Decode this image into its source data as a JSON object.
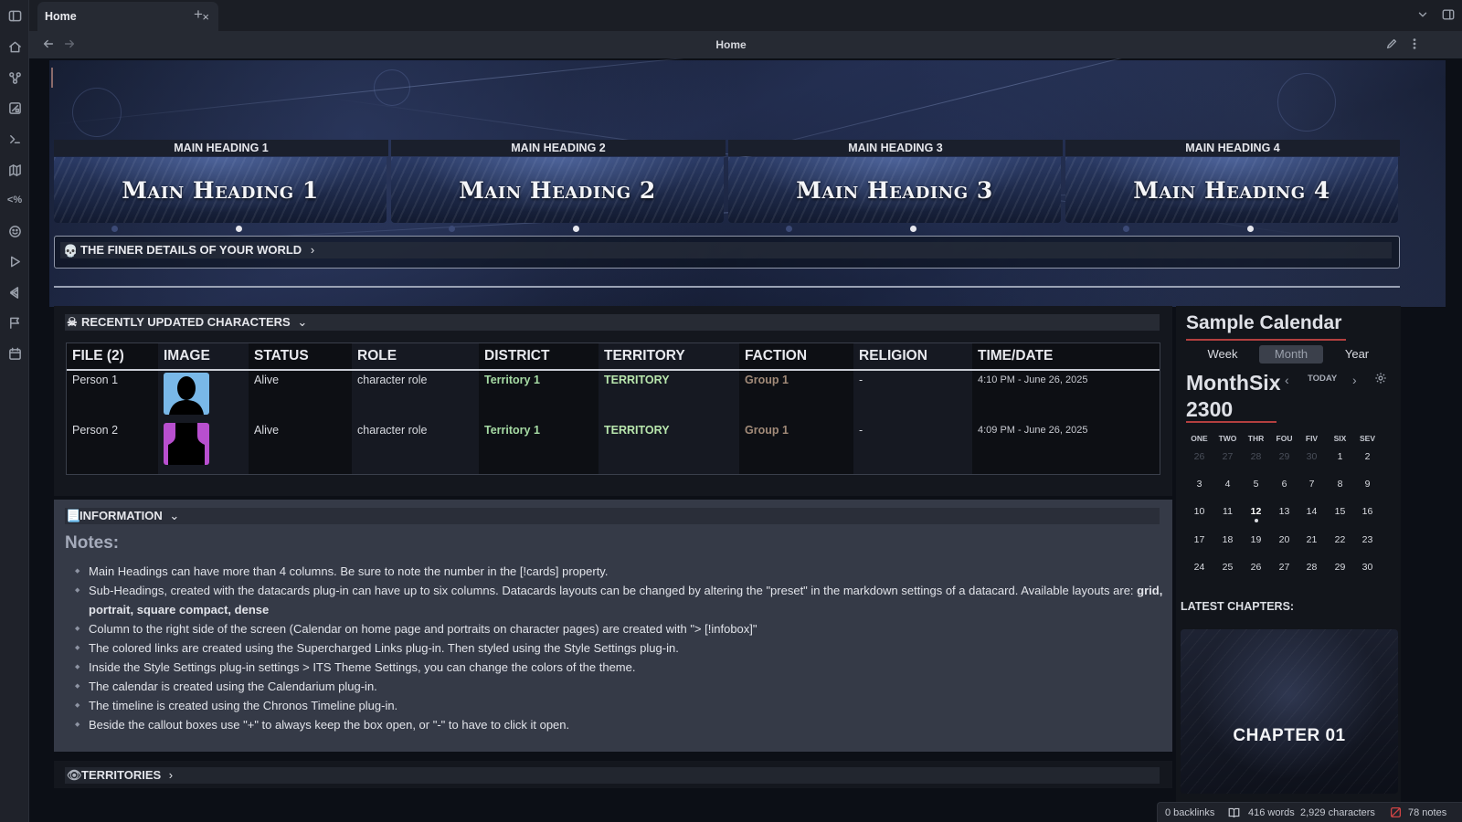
{
  "tabs": {
    "active": "Home",
    "close_glyph": "×",
    "new_glyph": "+"
  },
  "view": {
    "title": "Home"
  },
  "ribbon": [
    "sidebar-toggle-icon",
    "home-icon",
    "graph-icon",
    "canvas-icon",
    "terminal-icon",
    "map-icon",
    "percent-code-icon",
    "emoji-icon",
    "play-icon",
    "vscode-icon",
    "flag-icon",
    "calendar-icon"
  ],
  "cards": [
    {
      "label": "MAIN HEADING 1",
      "title": "Main Heading 1"
    },
    {
      "label": "MAIN HEADING 2",
      "title": "Main Heading 2"
    },
    {
      "label": "MAIN HEADING 3",
      "title": "Main Heading 3"
    },
    {
      "label": "MAIN HEADING 4",
      "title": "Main Heading 4"
    }
  ],
  "finer": {
    "icon": "💀",
    "label": "THE FINER DETAILS OF YOUR WORLD",
    "chevron": "›"
  },
  "characters": {
    "icon": "☠",
    "heading": "RECENTLY UPDATED CHARACTERS",
    "chevron": "⌄",
    "columns": [
      "FILE (2)",
      "IMAGE",
      "STATUS",
      "ROLE",
      "DISTRICT",
      "TERRITORY",
      "FACTION",
      "RELIGION",
      "TIME/DATE"
    ],
    "rows": [
      {
        "file": "Person 1",
        "portrait_color": "#79b8e8",
        "status": "Alive",
        "role": "character role",
        "district": "Territory 1",
        "territory": "TERRITORY",
        "faction": "Group 1",
        "religion": "-",
        "time": "4:10 PM - June 26, 2025"
      },
      {
        "file": "Person 2",
        "portrait_color": "#b84fcf",
        "status": "Alive",
        "role": "character role",
        "district": "Territory 1",
        "territory": "TERRITORY",
        "faction": "Group 1",
        "religion": "-",
        "time": "4:09 PM - June 26, 2025"
      }
    ]
  },
  "information": {
    "icon": "📃",
    "heading": "INFORMATION",
    "chevron": "⌄",
    "notes_title": "Notes:",
    "notes": [
      "Main Headings can have more than 4 columns. Be sure to note the number in the [!cards] property.",
      "Sub-Headings, created with the datacards plug-in can have up to six columns. Datacards layouts can be changed by altering the \"preset\" in the markdown settings of a datacard. Available layouts are: ",
      "Column to the right side of the screen (Calendar on home page and portraits on character pages) are created with \"> [!infobox]\"",
      "The colored links are created using the Supercharged Links plug-in. Then styled using the Style Settings plug-in.",
      "Inside the Style Settings plug-in settings > ITS Theme Settings, you can change the colors of the theme.",
      "The calendar is created using the Calendarium plug-in.",
      "The timeline is created using the Chronos Timeline plug-in.",
      "Beside the callout boxes use \"+\" to always keep the box open, or \"-\" to have to click it open."
    ],
    "layouts_bold": "grid, portrait, square compact, dense"
  },
  "territories": {
    "icon": "👁",
    "heading": "TERRITORIES",
    "chevron": "›"
  },
  "calendar": {
    "title": "Sample Calendar",
    "views": [
      "Week",
      "Month",
      "Year"
    ],
    "active_view": "Month",
    "month": "MonthSix",
    "year": "2300",
    "today_label": "TODAY",
    "prev": "‹",
    "next": "›",
    "weekdays": [
      "ONE",
      "TWO",
      "THR",
      "FOU",
      "FIV",
      "SIX",
      "SEV"
    ],
    "weeks": [
      [
        "26",
        "27",
        "28",
        "29",
        "30",
        "1",
        "2"
      ],
      [
        "3",
        "4",
        "5",
        "6",
        "7",
        "8",
        "9"
      ],
      [
        "10",
        "11",
        "12",
        "13",
        "14",
        "15",
        "16"
      ],
      [
        "17",
        "18",
        "19",
        "20",
        "21",
        "22",
        "23"
      ],
      [
        "24",
        "25",
        "26",
        "27",
        "28",
        "29",
        "30"
      ]
    ],
    "muted_leading": 5,
    "today": "12",
    "latest_label": "LATEST CHAPTERS:",
    "chapter": "CHAPTER 01"
  },
  "status": {
    "backlinks": "0 backlinks",
    "words": "416 words",
    "chars": "2,929 characters",
    "notes": "78 notes"
  }
}
